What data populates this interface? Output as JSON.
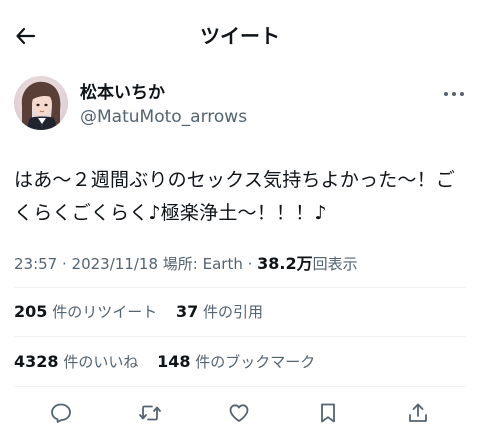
{
  "header": {
    "title": "ツイート"
  },
  "author": {
    "display_name": "松本いちか",
    "handle": "@MatuMoto_arrows"
  },
  "tweet": {
    "text": "はあ〜２週間ぶりのセックス気持ちよかった〜！ごくらくごくらく♪極楽浄土〜！！！♪"
  },
  "meta": {
    "time": "23:57",
    "separator": " · ",
    "date": "2023/11/18",
    "location": " 場所: Earth · ",
    "views_count": "38.2万",
    "views_label": "回表示"
  },
  "stats": {
    "retweets_count": "205",
    "retweets_label": "件のリツイート",
    "quotes_count": "37",
    "quotes_label": "件の引用",
    "likes_count": "4328",
    "likes_label": "件のいいね",
    "bookmarks_count": "148",
    "bookmarks_label": "件のブックマーク"
  },
  "icons": {
    "back": "arrow-left-icon",
    "more": "more-horizontal-icon",
    "reply": "comment-icon",
    "retweet": "retweet-icon",
    "like": "heart-icon",
    "bookmark": "bookmark-icon",
    "share": "share-icon"
  },
  "colors": {
    "text_primary": "#0f1419",
    "text_secondary": "#536471",
    "divider": "#eff3f4"
  }
}
